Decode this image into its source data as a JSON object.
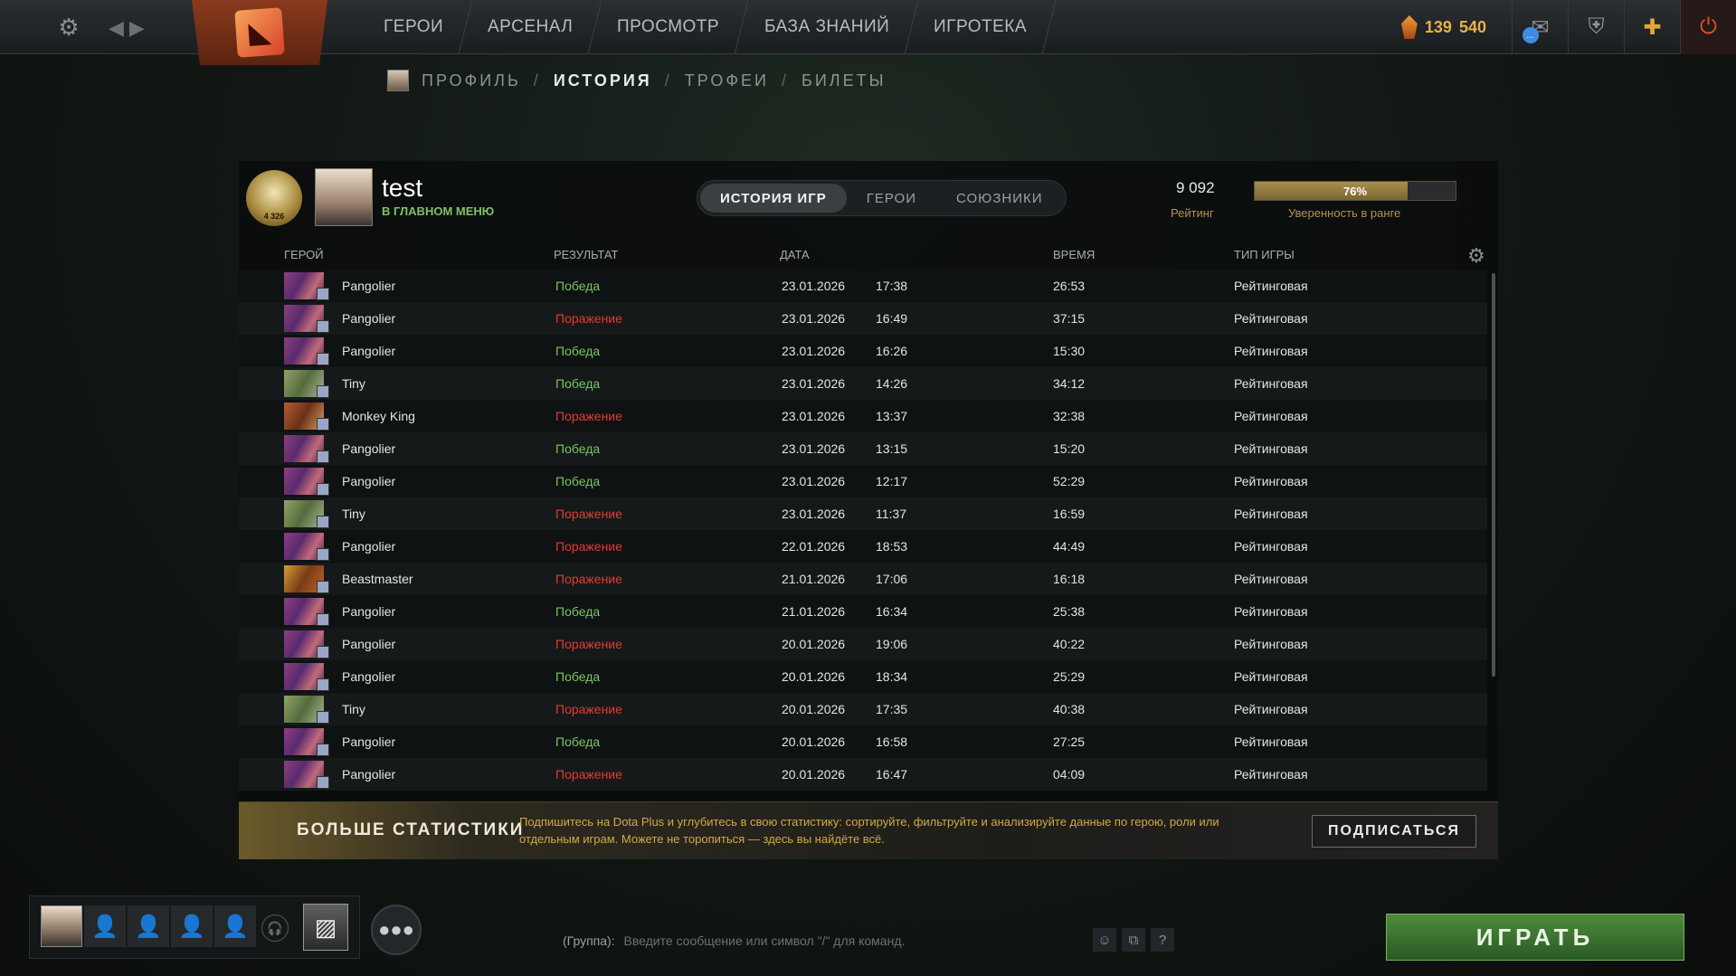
{
  "topbar": {
    "nav": [
      "ГЕРОИ",
      "АРСЕНАЛ",
      "ПРОСМОТР",
      "БАЗА ЗНАНИЙ",
      "ИГРОТЕКА"
    ],
    "shards": [
      "139",
      "540"
    ],
    "msg_badge": "..."
  },
  "breadcrumb": {
    "profile": "ПРОФИЛЬ",
    "history": "ИСТОРИЯ",
    "trophies": "ТРОФЕИ",
    "tickets": "БИЛЕТЫ",
    "sep": "/"
  },
  "profile": {
    "medal_text": "4 326",
    "name": "test",
    "status": "В ГЛАВНОМ МЕНЮ",
    "tabs": [
      "ИСТОРИЯ ИГР",
      "ГЕРОИ",
      "СОЮЗНИКИ"
    ],
    "rating_value": "9 092",
    "rating_label": "Рейтинг",
    "confidence_text": "76%",
    "confidence_fraction": 0.76,
    "confidence_label": "Уверенность в ранге"
  },
  "columns": {
    "hero": "ГЕРОЙ",
    "result": "РЕЗУЛЬТАТ",
    "date": "ДАТА",
    "time": "ВРЕМЯ",
    "type": "ТИП ИГРЫ"
  },
  "matches": [
    {
      "hero": "Pangolier",
      "hero_key": "pangolier",
      "result": "Победа",
      "win": true,
      "date": "23.01.2026",
      "clock": "17:38",
      "duration": "26:53",
      "type": "Рейтинговая"
    },
    {
      "hero": "Pangolier",
      "hero_key": "pangolier",
      "result": "Поражение",
      "win": false,
      "date": "23.01.2026",
      "clock": "16:49",
      "duration": "37:15",
      "type": "Рейтинговая"
    },
    {
      "hero": "Pangolier",
      "hero_key": "pangolier",
      "result": "Победа",
      "win": true,
      "date": "23.01.2026",
      "clock": "16:26",
      "duration": "15:30",
      "type": "Рейтинговая"
    },
    {
      "hero": "Tiny",
      "hero_key": "tiny",
      "result": "Победа",
      "win": true,
      "date": "23.01.2026",
      "clock": "14:26",
      "duration": "34:12",
      "type": "Рейтинговая"
    },
    {
      "hero": "Monkey King",
      "hero_key": "monkey-king",
      "result": "Поражение",
      "win": false,
      "date": "23.01.2026",
      "clock": "13:37",
      "duration": "32:38",
      "type": "Рейтинговая"
    },
    {
      "hero": "Pangolier",
      "hero_key": "pangolier",
      "result": "Победа",
      "win": true,
      "date": "23.01.2026",
      "clock": "13:15",
      "duration": "15:20",
      "type": "Рейтинговая"
    },
    {
      "hero": "Pangolier",
      "hero_key": "pangolier",
      "result": "Победа",
      "win": true,
      "date": "23.01.2026",
      "clock": "12:17",
      "duration": "52:29",
      "type": "Рейтинговая"
    },
    {
      "hero": "Tiny",
      "hero_key": "tiny",
      "result": "Поражение",
      "win": false,
      "date": "23.01.2026",
      "clock": "11:37",
      "duration": "16:59",
      "type": "Рейтинговая"
    },
    {
      "hero": "Pangolier",
      "hero_key": "pangolier",
      "result": "Поражение",
      "win": false,
      "date": "22.01.2026",
      "clock": "18:53",
      "duration": "44:49",
      "type": "Рейтинговая"
    },
    {
      "hero": "Beastmaster",
      "hero_key": "beastmaster",
      "result": "Поражение",
      "win": false,
      "date": "21.01.2026",
      "clock": "17:06",
      "duration": "16:18",
      "type": "Рейтинговая"
    },
    {
      "hero": "Pangolier",
      "hero_key": "pangolier",
      "result": "Победа",
      "win": true,
      "date": "21.01.2026",
      "clock": "16:34",
      "duration": "25:38",
      "type": "Рейтинговая"
    },
    {
      "hero": "Pangolier",
      "hero_key": "pangolier",
      "result": "Поражение",
      "win": false,
      "date": "20.01.2026",
      "clock": "19:06",
      "duration": "40:22",
      "type": "Рейтинговая"
    },
    {
      "hero": "Pangolier",
      "hero_key": "pangolier",
      "result": "Победа",
      "win": true,
      "date": "20.01.2026",
      "clock": "18:34",
      "duration": "25:29",
      "type": "Рейтинговая"
    },
    {
      "hero": "Tiny",
      "hero_key": "tiny",
      "result": "Поражение",
      "win": false,
      "date": "20.01.2026",
      "clock": "17:35",
      "duration": "40:38",
      "type": "Рейтинговая"
    },
    {
      "hero": "Pangolier",
      "hero_key": "pangolier",
      "result": "Победа",
      "win": true,
      "date": "20.01.2026",
      "clock": "16:58",
      "duration": "27:25",
      "type": "Рейтинговая"
    },
    {
      "hero": "Pangolier",
      "hero_key": "pangolier",
      "result": "Поражение",
      "win": false,
      "date": "20.01.2026",
      "clock": "16:47",
      "duration": "04:09",
      "type": "Рейтинговая"
    }
  ],
  "dota_plus": {
    "title": "БОЛЬШЕ СТАТИСТИКИ",
    "text": "Подпишитесь на Dota Plus и углубитесь в свою статистику: сортируйте, фильтруйте и анализируйте данные по герою, роли или отдельным играм. Можете не торопиться — здесь вы найдёте всё.",
    "button": "ПОДПИСАТЬСЯ"
  },
  "chat": {
    "label": "(Группа):",
    "placeholder": "Введите сообщение или символ \"/\" для команд."
  },
  "play_button": "ИГРАТЬ",
  "colors": {
    "win": "#77c760",
    "loss": "#e23c33",
    "accent_gold": "#b29350",
    "play_green": "#3d7a31"
  },
  "icons": [
    "gear-icon",
    "back-arrow-icon",
    "dota-logo-icon",
    "shard-icon",
    "mail-icon",
    "shield-icon",
    "plus-icon",
    "power-icon",
    "columns-gear-icon",
    "voice-icon",
    "party-card-icon",
    "group-icon",
    "smile-icon",
    "emote-icon",
    "help-icon"
  ]
}
